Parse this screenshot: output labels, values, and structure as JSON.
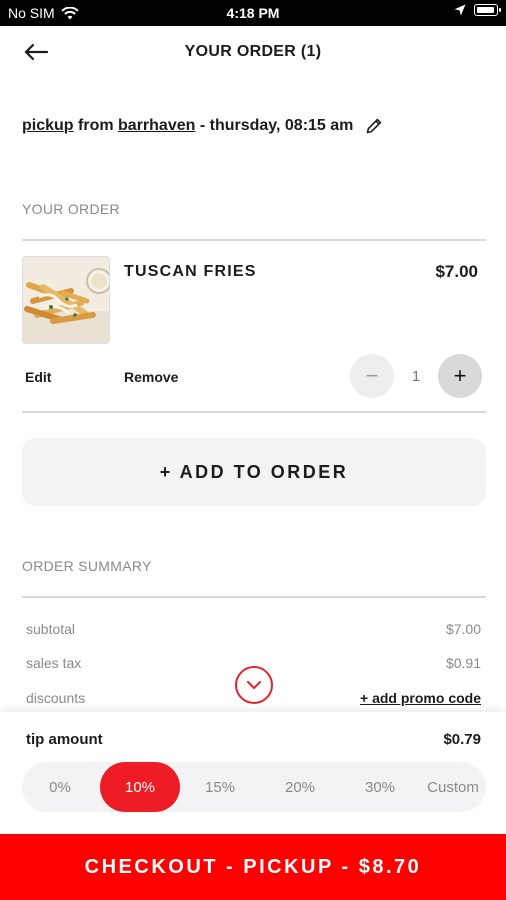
{
  "status_bar": {
    "carrier": "No SIM",
    "time": "4:18 PM",
    "icons": [
      "wifi-icon",
      "location-arrow-icon",
      "battery-icon"
    ]
  },
  "header": {
    "title": "YOUR ORDER (1)",
    "back_icon": "arrow-left-icon"
  },
  "pickup": {
    "mode": "pickup",
    "from_text": "from",
    "location": "barrhaven",
    "schedule": "- thursday, 08:15 am",
    "edit_icon": "pencil-icon"
  },
  "order_section": {
    "label": "YOUR ORDER",
    "items": [
      {
        "name": "TUSCAN FRIES",
        "price": "$7.00",
        "quantity": "1",
        "edit_label": "Edit",
        "remove_label": "Remove",
        "minus_symbol": "−",
        "plus_symbol": "+"
      }
    ],
    "add_button": "+ ADD TO ORDER"
  },
  "summary": {
    "label": "ORDER SUMMARY",
    "rows": [
      {
        "label": "subtotal",
        "value": "$7.00"
      },
      {
        "label": "sales tax",
        "value": "$0.91"
      },
      {
        "label": "discounts",
        "value": "+ add promo code"
      }
    ],
    "expand_icon": "chevron-down-icon"
  },
  "tip": {
    "label": "tip amount",
    "value": "$0.79",
    "options": [
      "0%",
      "10%",
      "15%",
      "20%",
      "30%",
      "Custom"
    ],
    "selected": "10%"
  },
  "checkout": {
    "label": "CHECKOUT - PICKUP - $8.70"
  },
  "colors": {
    "accent": "#ee1c25",
    "checkout_bg": "#ff0000",
    "muted_text": "#8a8a8a",
    "panel_bg": "#f3f3f6"
  }
}
